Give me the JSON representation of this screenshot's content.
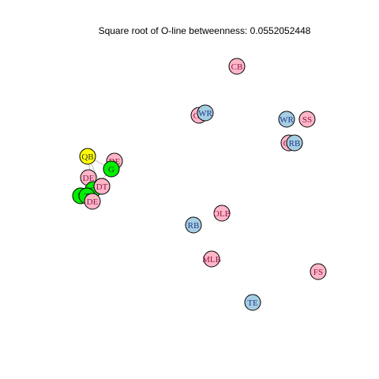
{
  "title": "Square root of O-line betweenness: 0.0552052448",
  "colors": {
    "pink": "#ffb6c8",
    "lightblue": "#a6cee3",
    "green": "#00ee00",
    "yellow": "#ffff00",
    "pink_label": "#8b1a4a",
    "blue_label": "#1f3a8a",
    "edge": "#bfbfbf",
    "outline": "#000000"
  },
  "nodes": [
    {
      "label": "CB",
      "color": "pink"
    },
    {
      "label": "CB",
      "color": "pink"
    },
    {
      "label": "WR",
      "color": "lightblue"
    },
    {
      "label": "WR",
      "color": "lightblue"
    },
    {
      "label": "SS",
      "color": "pink"
    },
    {
      "label": "CB",
      "color": "pink"
    },
    {
      "label": "RB",
      "color": "lightblue"
    },
    {
      "label": "QB",
      "color": "yellow"
    },
    {
      "label": "DE",
      "color": "pink"
    },
    {
      "label": "G",
      "color": "green"
    },
    {
      "label": "DE",
      "color": "pink"
    },
    {
      "label": "C",
      "color": "green"
    },
    {
      "label": "G",
      "color": "green"
    },
    {
      "label": "DT",
      "color": "pink"
    },
    {
      "label": "T",
      "color": "green"
    },
    {
      "label": "T",
      "color": "green"
    },
    {
      "label": "DE",
      "color": "pink"
    },
    {
      "label": "OLB",
      "color": "pink"
    },
    {
      "label": "RB",
      "color": "lightblue"
    },
    {
      "label": "MLB",
      "color": "pink"
    },
    {
      "label": "FS",
      "color": "pink"
    },
    {
      "label": "TE",
      "color": "lightblue"
    }
  ],
  "edges": [
    [
      7,
      9
    ],
    [
      7,
      11
    ],
    [
      7,
      12
    ],
    [
      9,
      11
    ],
    [
      11,
      12
    ],
    [
      12,
      14
    ],
    [
      14,
      15
    ],
    [
      11,
      15
    ],
    [
      9,
      8
    ],
    [
      11,
      13
    ]
  ]
}
